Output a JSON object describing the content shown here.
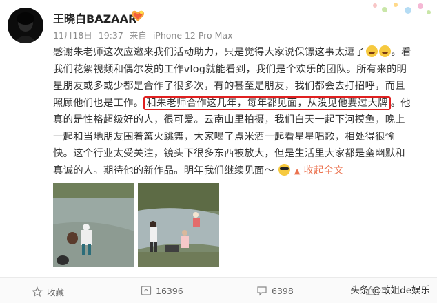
{
  "user": {
    "name": "王晓白BAZAAR",
    "badge_icon": "fan-badge-icon"
  },
  "meta": {
    "date": "11月18日",
    "time": "19:37",
    "source_prefix": "来自",
    "source": "iPhone 12 Pro Max"
  },
  "post": {
    "lines": [
      "感谢朱老师这次应邀来我们活动助力，只是觉得大家说保镖这事太逗了",
      "。看",
      "我们花絮视频和偶尔发的工作vlog就能看到，我们是个欢乐的团队。所有来的明",
      "星朋友或多或少都是合作了很多次，有的甚至是朋友，我们都会去打招呼，而且",
      "照顾他们也是工作。",
      "和朱老师合作这几年，每年都见面，从没见他要过大牌",
      "。他",
      "真的是性格超级好的人，很可爱。云南山里拍摄，我们白天一起下河摸鱼，晚上",
      "一起和当地朋友围着篝火跳舞，大家喝了点米酒一起看星星唱歌，相处得很愉",
      "快。这个行业太受关注，镜头下很多东西被放大，但是生活里大家都是蛮幽默和",
      "真诚的人。期待他的新作品。明年我们继续见面～"
    ],
    "collapse_label": "收起全文",
    "collapse_icon": "chevron-up-icon"
  },
  "actions": {
    "favorite_label": "收藏",
    "repost_count": "16396",
    "comment_count": "6398",
    "like_icon": "thumbs-up-icon"
  },
  "watermark": "头条 @敢姐de娱乐",
  "colors": {
    "link": "#eb7350",
    "highlight_border": "#e02020",
    "text": "#333333",
    "meta": "#8a8a8a"
  }
}
